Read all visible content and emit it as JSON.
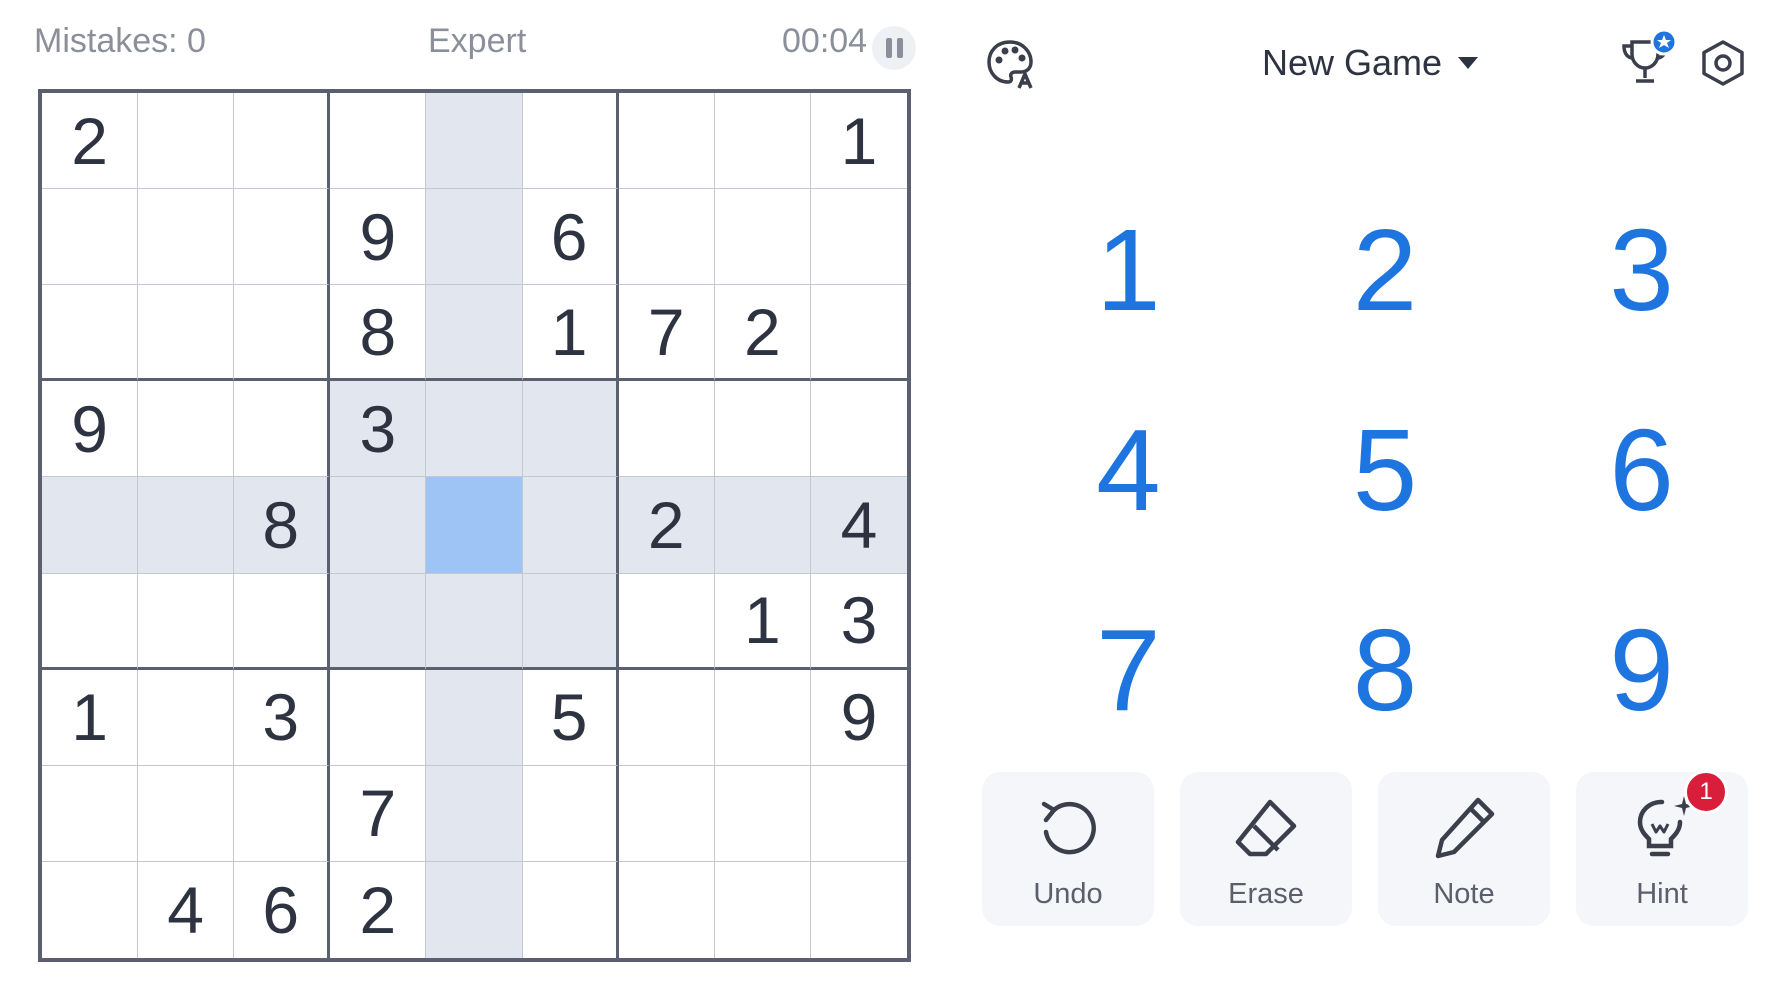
{
  "status": {
    "mistakes": "Mistakes: 0",
    "difficulty": "Expert",
    "timer": "00:04"
  },
  "board": {
    "selected": [
      4,
      4
    ],
    "highlight_color": "#e2e6ef",
    "selected_color": "#9ec4f6",
    "rows": [
      [
        "2",
        "",
        "",
        "",
        "",
        "",
        "",
        "",
        "1"
      ],
      [
        "",
        "",
        "",
        "9",
        "",
        "6",
        "",
        "",
        ""
      ],
      [
        "",
        "",
        "",
        "8",
        "",
        "1",
        "7",
        "2",
        ""
      ],
      [
        "9",
        "",
        "",
        "3",
        "",
        "",
        "",
        "",
        ""
      ],
      [
        "",
        "",
        "8",
        "",
        "",
        "",
        "2",
        "",
        "4"
      ],
      [
        "",
        "",
        "",
        "",
        "",
        "",
        "",
        "1",
        "3"
      ],
      [
        "1",
        "",
        "3",
        "",
        "",
        "5",
        "",
        "",
        "9"
      ],
      [
        "",
        "",
        "",
        "7",
        "",
        "",
        "",
        "",
        ""
      ],
      [
        "",
        "4",
        "6",
        "2",
        "",
        "",
        "",
        "",
        ""
      ]
    ]
  },
  "header": {
    "new_game": "New Game"
  },
  "numpad": {
    "accent": "#1f75e0",
    "numbers": [
      "1",
      "2",
      "3",
      "4",
      "5",
      "6",
      "7",
      "8",
      "9"
    ]
  },
  "actions": {
    "undo": "Undo",
    "erase": "Erase",
    "note": "Note",
    "hint": "Hint",
    "hint_count": "1"
  },
  "icons": {
    "theme": "palette-icon",
    "awards": "trophy-star-icon",
    "settings": "hexagon-settings-icon"
  }
}
